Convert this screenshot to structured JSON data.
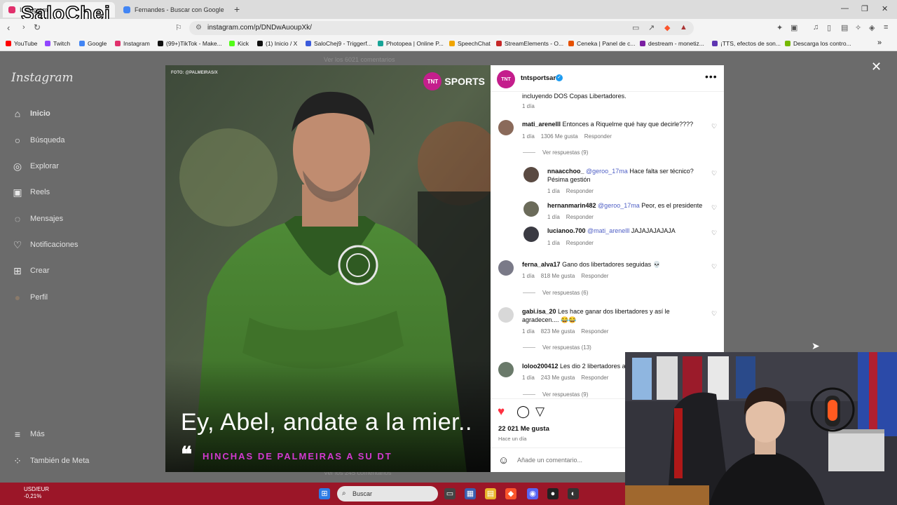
{
  "browser": {
    "tabs": [
      {
        "label": "Instagram",
        "active": true
      },
      {
        "label": "Fernandes - Buscar con Google",
        "active": false
      }
    ],
    "overlay_brand": "SaloChej",
    "url": "instagram.com/p/DNDwAuoupXk/",
    "bookmarks": [
      {
        "label": "YouTube",
        "color": "#ff0000"
      },
      {
        "label": "Twitch",
        "color": "#9146ff"
      },
      {
        "label": "Google",
        "color": "#4285f4"
      },
      {
        "label": "Instagram",
        "color": "#e1306c"
      },
      {
        "label": "(99+)TikTok - Make...",
        "color": "#111111"
      },
      {
        "label": "Kick",
        "color": "#53fc18"
      },
      {
        "label": "(1) Inicio / X",
        "color": "#111111"
      },
      {
        "label": "SaloChej9 - Triggerf...",
        "color": "#3b5bdb"
      },
      {
        "label": "Photopea | Online P...",
        "color": "#18a497"
      },
      {
        "label": "SpeechChat",
        "color": "#f0a500"
      },
      {
        "label": "StreamElements - O...",
        "color": "#c62828"
      },
      {
        "label": "Ceneka | Panel de c...",
        "color": "#e65100"
      },
      {
        "label": "destream - monetiz...",
        "color": "#7b1fa2"
      },
      {
        "label": "¡TTS, efectos de son...",
        "color": "#5e35b1"
      },
      {
        "label": "Descarga los contro...",
        "color": "#76b900"
      }
    ]
  },
  "instagram": {
    "logo": "Instagram",
    "nav": [
      {
        "label": "Inicio",
        "icon": "home-icon",
        "glyph": "⌂"
      },
      {
        "label": "Búsqueda",
        "icon": "search-icon",
        "glyph": "○"
      },
      {
        "label": "Explorar",
        "icon": "compass-icon",
        "glyph": "◎"
      },
      {
        "label": "Reels",
        "icon": "reels-icon",
        "glyph": "▣"
      },
      {
        "label": "Mensajes",
        "icon": "messenger-icon",
        "glyph": "◌"
      },
      {
        "label": "Notificaciones",
        "icon": "heart-icon",
        "glyph": "♡"
      },
      {
        "label": "Crear",
        "icon": "plus-icon",
        "glyph": "⊞"
      },
      {
        "label": "Perfil",
        "icon": "profile-avatar",
        "glyph": "●"
      }
    ],
    "more": {
      "label": "Más",
      "glyph": "≡"
    },
    "meta": {
      "label": "También de Meta",
      "glyph": "⁘"
    },
    "faded_top": "Ver los 6021 comentarios",
    "faded_bottom": "Ver los 245 comentarios"
  },
  "post": {
    "photo_credit": "FOTO: @PALMEIRAS/X",
    "brand": {
      "badge": "TNT",
      "word": "SPORTS"
    },
    "headline": "Ey, Abel, andate a la mier..",
    "quote_mark": "❝",
    "subhead": "HINCHAS DE PALMEIRAS A SU DT",
    "author": "tntsportsar",
    "likes": "22 021 Me gusta",
    "posted": "Hace un día",
    "add_comment_placeholder": "Añade un comentario...",
    "comments": {
      "caption_tail": "incluyendo DOS Copas Libertadores.",
      "caption_time": "1 día",
      "c1": {
        "user": "mati_arenelll",
        "text": "Entonces a Riquelme qué hay que decirle????",
        "time": "1 día",
        "likes": "1306 Me gusta",
        "reply": "Responder",
        "view": "Ver respuestas (9)"
      },
      "r1": {
        "user": "nnaacchoo_",
        "mention": "@geroo_17ma",
        "text": "Hace falta ser técnico? Pésima gestión",
        "time": "1 día",
        "reply": "Responder"
      },
      "r2": {
        "user": "hernanmarin482",
        "mention": "@geroo_17ma",
        "text": "Peor, es el presidente",
        "time": "1 día",
        "reply": "Responder"
      },
      "r3": {
        "user": "lucianoo.700",
        "mention": "@mati_arenelll",
        "text": "JAJAJAJAJAJA",
        "time": "1 día",
        "reply": "Responder"
      },
      "c2": {
        "user": "ferna_alva17",
        "text": "Gano dos libertadores seguidas 💀",
        "time": "1 día",
        "likes": "818 Me gusta",
        "reply": "Responder",
        "view": "Ver respuestas (6)"
      },
      "c3": {
        "user": "gabi.isa_20",
        "text": "Les hace ganar dos libertadores y así le agradecen.... 😂😂",
        "time": "1 día",
        "likes": "823 Me gusta",
        "reply": "Responder",
        "view": "Ver respuestas (13)"
      },
      "c4": {
        "user": "loloo200412",
        "text": "Les dio 2 libertadores a",
        "time": "1 día",
        "likes": "243 Me gusta",
        "reply": "Responder",
        "view": "Ver respuestas (9)"
      }
    }
  },
  "taskbar": {
    "stock_name": "USD/EUR",
    "stock_change": "-0,21%",
    "search_label": "Buscar"
  },
  "colors": {
    "accent": "#c41e8c",
    "taskbar": "#9b1628",
    "like": "#ff3040"
  }
}
